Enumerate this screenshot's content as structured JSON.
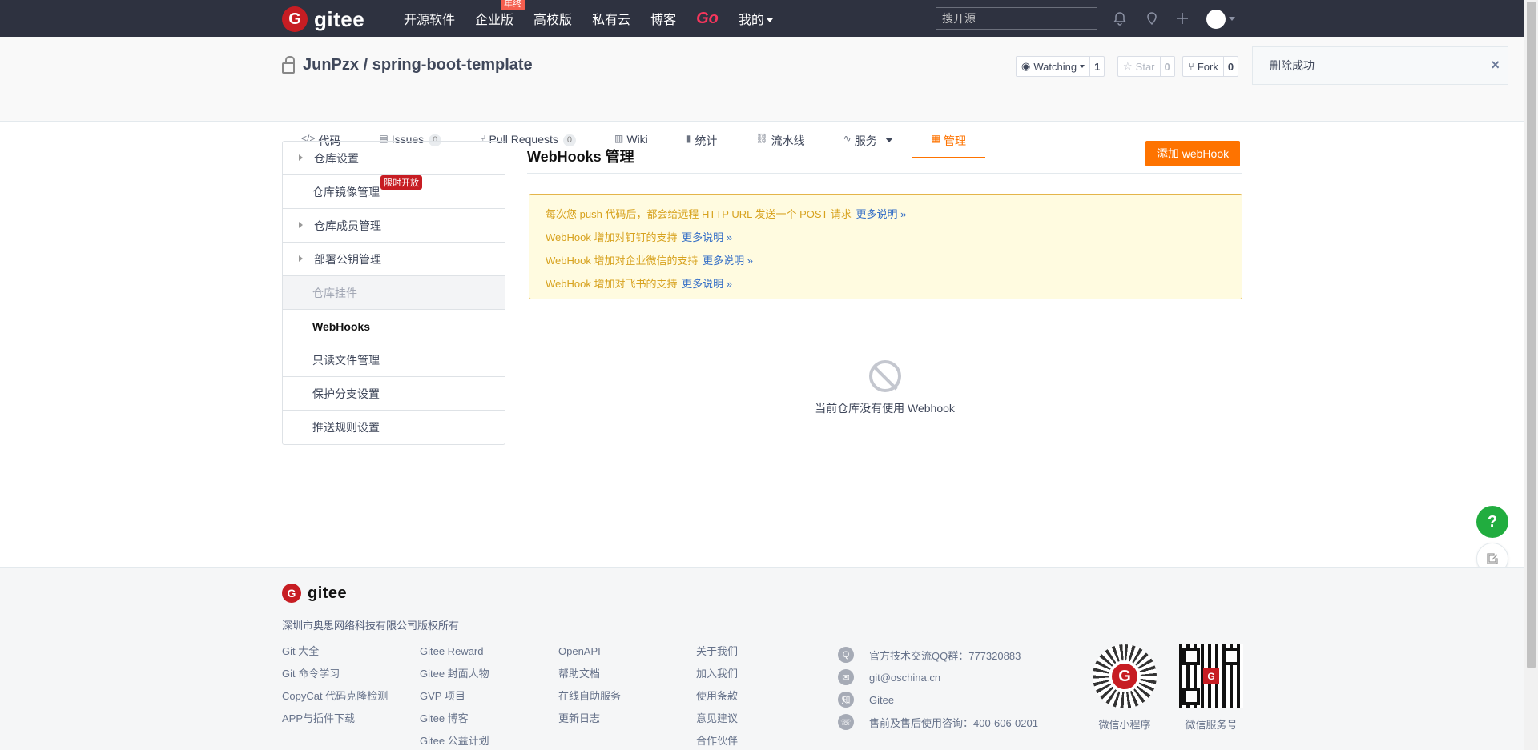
{
  "topnav": {
    "logo_mark": "G",
    "logo_text": "gitee",
    "links": [
      "开源软件",
      "企业版",
      "高校版",
      "私有云",
      "博客",
      "Go",
      "我的"
    ],
    "enterprise_badge": "年终",
    "search_placeholder": "搜开源"
  },
  "project": {
    "title": "JunPzx / spring-boot-template",
    "watch_label": "Watching",
    "watch_count": "1",
    "star_label": "Star",
    "star_count": "0",
    "fork_label": "Fork",
    "fork_count": "0"
  },
  "toast": {
    "message": "删除成功",
    "close": "×"
  },
  "tabs": [
    {
      "icon": "</>",
      "label": "代码"
    },
    {
      "icon": "▤",
      "label": "Issues",
      "count": "0"
    },
    {
      "icon": "⑂",
      "label": "Pull Requests",
      "count": "0"
    },
    {
      "icon": "▥",
      "label": "Wiki"
    },
    {
      "icon": "▮",
      "label": "统计"
    },
    {
      "icon": "⛓",
      "label": "流水线"
    },
    {
      "icon": "∿",
      "label": "服务"
    },
    {
      "icon": "▦",
      "label": "管理"
    }
  ],
  "sidebar": {
    "items": [
      "仓库设置",
      "仓库镜像管理",
      "仓库成员管理",
      "部署公钥管理",
      "仓库挂件",
      "WebHooks",
      "只读文件管理",
      "保护分支设置",
      "推送规则设置"
    ],
    "mirror_badge": "限时开放"
  },
  "main": {
    "title": "WebHooks 管理",
    "add_button": "添加 webHook",
    "notices": [
      {
        "text": "每次您 push 代码后，都会给远程 HTTP URL 发送一个 POST 请求",
        "more": "更多说明 »"
      },
      {
        "text": "WebHook 增加对钉钉的支持",
        "more": "更多说明 »"
      },
      {
        "text": "WebHook 增加对企业微信的支持",
        "more": "更多说明 »"
      },
      {
        "text": "WebHook 增加对飞书的支持",
        "more": "更多说明 »"
      }
    ],
    "empty_text": "当前仓库没有使用 Webhook"
  },
  "fab": {
    "help": "?"
  },
  "footer": {
    "logo_text": "gitee",
    "copyright": "深圳市奥思网络科技有限公司版权所有",
    "col1": [
      "Git 大全",
      "Git 命令学习",
      "CopyCat 代码克隆检测",
      "APP与插件下载"
    ],
    "col2": [
      "Gitee Reward",
      "Gitee 封面人物",
      "GVP 项目",
      "Gitee 博客",
      "Gitee 公益计划"
    ],
    "col3": [
      "OpenAPI",
      "帮助文档",
      "在线自助服务",
      "更新日志"
    ],
    "col4": [
      "关于我们",
      "加入我们",
      "使用条款",
      "意见建议",
      "合作伙伴"
    ],
    "contacts": [
      {
        "icon": "Q",
        "text": "官方技术交流QQ群：777320883"
      },
      {
        "icon": "✉",
        "text": "git@oschina.cn"
      },
      {
        "icon": "知",
        "text": "Gitee"
      },
      {
        "icon": "☏",
        "text": "售前及售后使用咨询：400-606-0201"
      }
    ],
    "qr1_label": "微信小程序",
    "qr2_label": "微信服务号"
  }
}
